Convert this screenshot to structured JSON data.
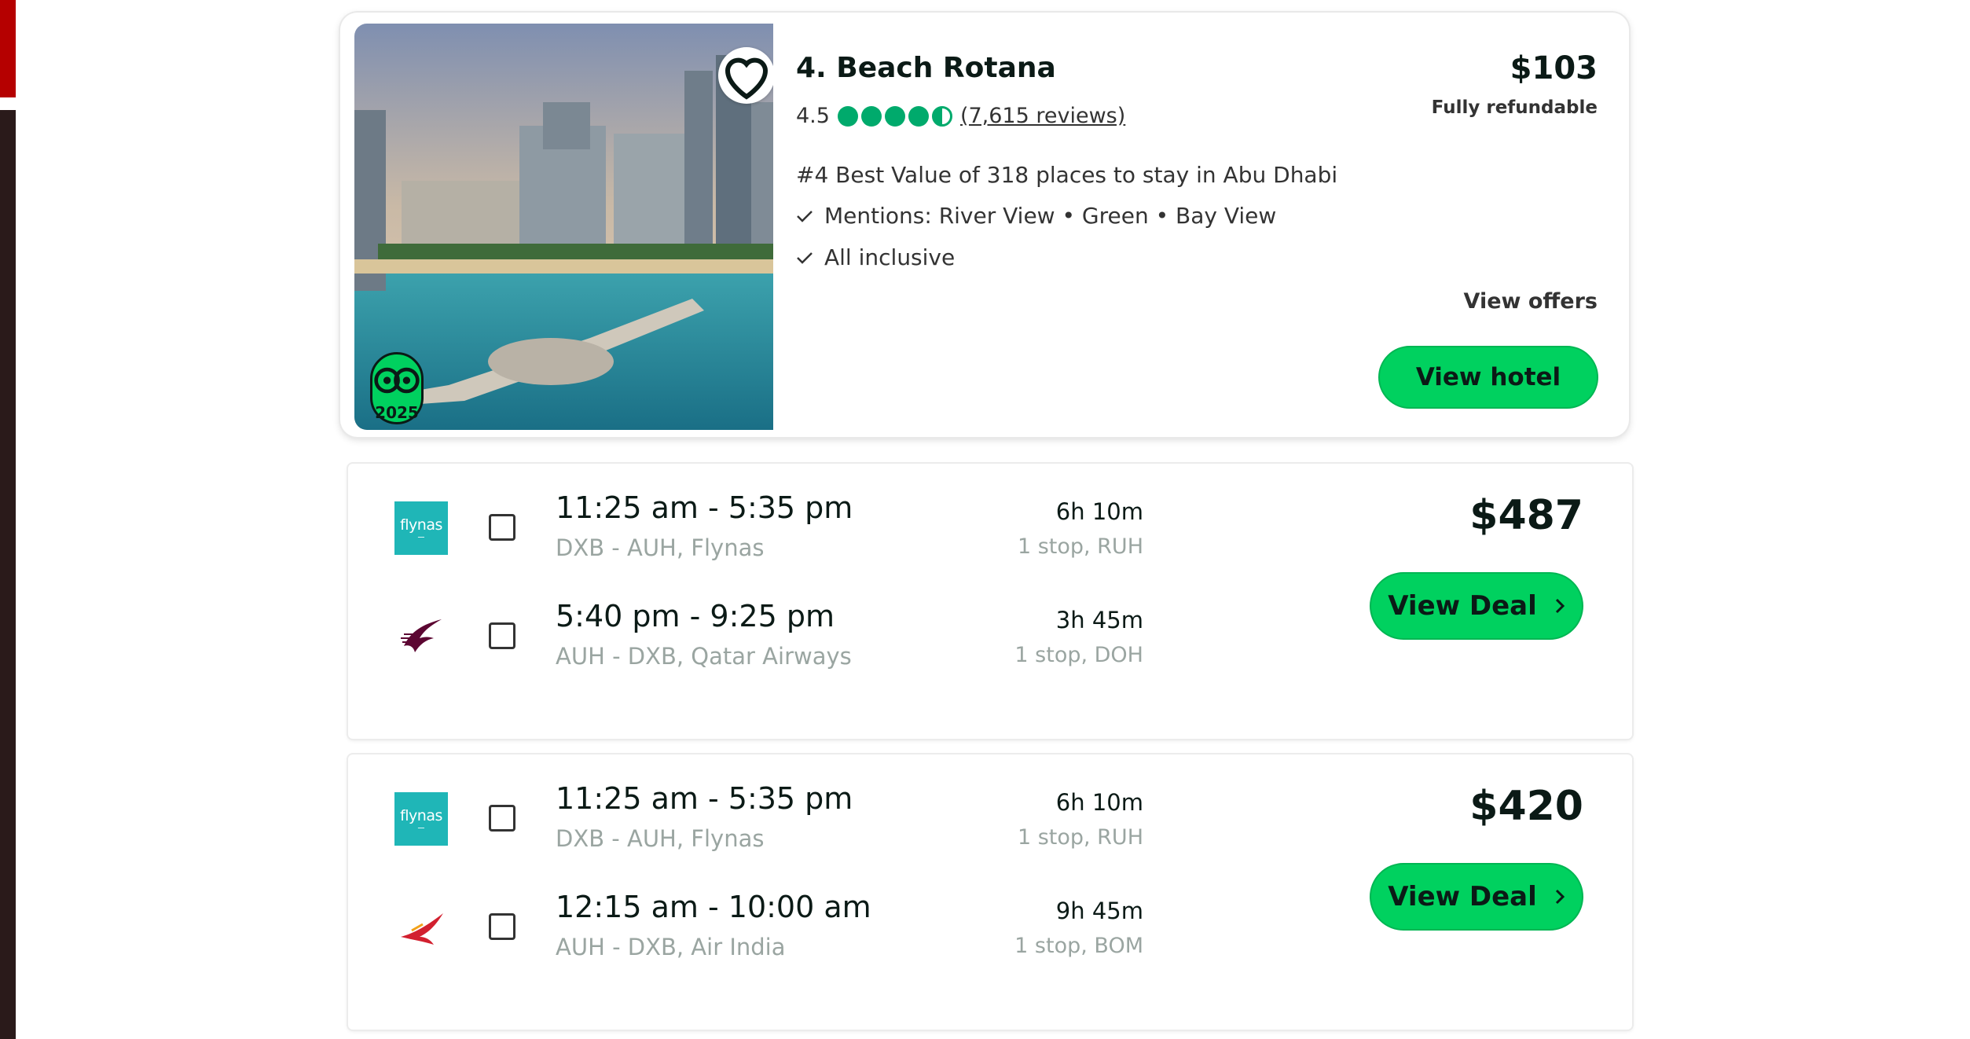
{
  "hotel": {
    "title": "4. Beach Rotana",
    "rating": "4.5",
    "rating_value": 4.5,
    "reviews": "(7,615 reviews)",
    "best_value": "#4 Best Value of 318 places to stay in Abu Dhabi",
    "mentions": "Mentions: River View • Green • Bay View",
    "amenity": "All inclusive",
    "price": "$103",
    "refund_note": "Fully refundable",
    "view_offers": "View offers",
    "view_hotel": "View hotel",
    "award_year": "2025"
  },
  "flights": [
    {
      "price": "$487",
      "button": "View Deal",
      "legs": [
        {
          "airline": "Flynas",
          "logo": "flynas-logo",
          "logo_text": "flynas",
          "times": "11:25 am - 5:35 pm",
          "route": "DXB - AUH, Flynas",
          "duration": "6h 10m",
          "stops": "1 stop, RUH"
        },
        {
          "airline": "Qatar Airways",
          "logo": "qatar-airways-logo",
          "times": "5:40 pm - 9:25 pm",
          "route": "AUH - DXB, Qatar Airways",
          "duration": "3h 45m",
          "stops": "1 stop, DOH"
        }
      ]
    },
    {
      "price": "$420",
      "button": "View Deal",
      "legs": [
        {
          "airline": "Flynas",
          "logo": "flynas-logo",
          "logo_text": "flynas",
          "times": "11:25 am - 5:35 pm",
          "route": "DXB - AUH, Flynas",
          "duration": "6h 10m",
          "stops": "1 stop, RUH"
        },
        {
          "airline": "Air India",
          "logo": "air-india-logo",
          "times": "12:15 am - 10:00 am",
          "route": "AUH - DXB, Air India",
          "duration": "9h 45m",
          "stops": "1 stop, BOM"
        }
      ]
    }
  ],
  "colors": {
    "accent_green": "#00d15f",
    "bubble_green": "#00aa6c",
    "text_dark": "#0b1a16",
    "text_muted": "#9aa5a1",
    "flynas_teal": "#1fb6b7",
    "qatar_maroon": "#5c0632",
    "air_india_red": "#d2202f"
  }
}
